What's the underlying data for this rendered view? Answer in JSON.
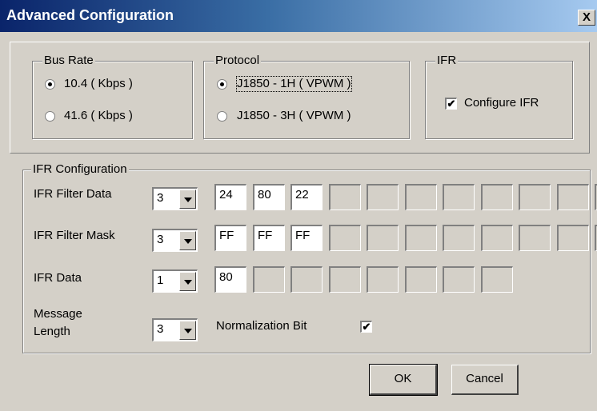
{
  "window": {
    "title": "Advanced Configuration",
    "close_label": "X"
  },
  "bus_rate": {
    "legend": "Bus Rate",
    "options": [
      {
        "label": "10.4  ( Kbps )",
        "selected": true
      },
      {
        "label": "41.6  ( Kbps )",
        "selected": false
      }
    ]
  },
  "protocol": {
    "legend": "Protocol",
    "options": [
      {
        "label": "J1850 - 1H ( VPWM )",
        "selected": true
      },
      {
        "label": "J1850 - 3H ( VPWM )",
        "selected": false
      }
    ]
  },
  "ifr": {
    "legend": "IFR",
    "configure_label": "Configure IFR",
    "configure_checked": true
  },
  "ifr_config": {
    "legend": "IFR Configuration",
    "filter_data": {
      "label": "IFR Filter Data",
      "count": "3",
      "bytes": [
        "24",
        "80",
        "22",
        "",
        "",
        "",
        "",
        "",
        "",
        "",
        ""
      ]
    },
    "filter_mask": {
      "label": "IFR Filter Mask",
      "count": "3",
      "bytes": [
        "FF",
        "FF",
        "FF",
        "",
        "",
        "",
        "",
        "",
        "",
        "",
        ""
      ]
    },
    "data": {
      "label": "IFR Data",
      "count": "1",
      "bytes": [
        "80",
        "",
        "",
        "",
        "",
        "",
        "",
        ""
      ]
    },
    "message_length": {
      "label_line1": "Message",
      "label_line2": "Length",
      "value": "3"
    },
    "normalization": {
      "label": "Normalization Bit",
      "checked": true
    }
  },
  "buttons": {
    "ok": "OK",
    "cancel": "Cancel"
  }
}
